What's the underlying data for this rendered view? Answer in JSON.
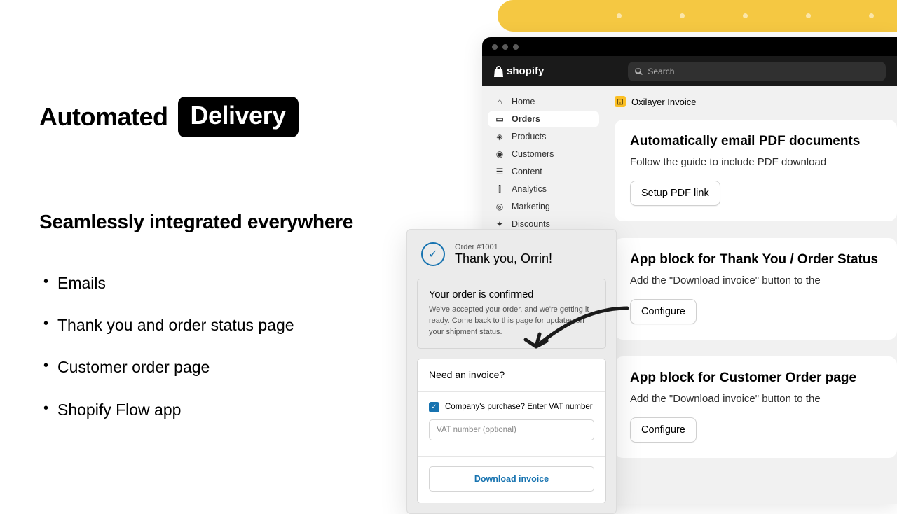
{
  "left": {
    "headline_plain": "Automated",
    "headline_highlight": "Delivery",
    "subhead": "Seamlessly integrated everywhere",
    "bullets": [
      "Emails",
      "Thank you and order status page",
      "Customer order page",
      "Shopify Flow app"
    ]
  },
  "app": {
    "platform": "shopify",
    "search_placeholder": "Search",
    "sidebar": [
      {
        "icon": "🏠",
        "label": "Home"
      },
      {
        "icon": "📦",
        "label": "Orders",
        "active": true
      },
      {
        "icon": "🏷️",
        "label": "Products"
      },
      {
        "icon": "👤",
        "label": "Customers"
      },
      {
        "icon": "📄",
        "label": "Content"
      },
      {
        "icon": "📊",
        "label": "Analytics"
      },
      {
        "icon": "📣",
        "label": "Marketing"
      },
      {
        "icon": "🏷️",
        "label": "Discounts"
      }
    ],
    "app_name": "Oxilayer Invoice",
    "cards": [
      {
        "title": "Automatically email PDF documents",
        "desc": "Follow the guide to include PDF download",
        "button": "Setup PDF link"
      },
      {
        "title": "App block for Thank You / Order Status",
        "desc": "Add the \"Download invoice\" button to the",
        "button": "Configure"
      },
      {
        "title": "App block for Customer Order page",
        "desc": "Add the \"Download invoice\" button to the",
        "button": "Configure"
      }
    ]
  },
  "popup": {
    "order_number": "Order #1001",
    "thanks": "Thank you, Orrin!",
    "confirmed_title": "Your order is confirmed",
    "confirmed_body": "We've accepted your order, and we're getting it ready. Come back to this page for updates on your shipment status.",
    "invoice_title": "Need an invoice?",
    "checkbox_label": "Company's purchase? Enter VAT number",
    "vat_placeholder": "VAT number (optional)",
    "download_label": "Download invoice"
  }
}
